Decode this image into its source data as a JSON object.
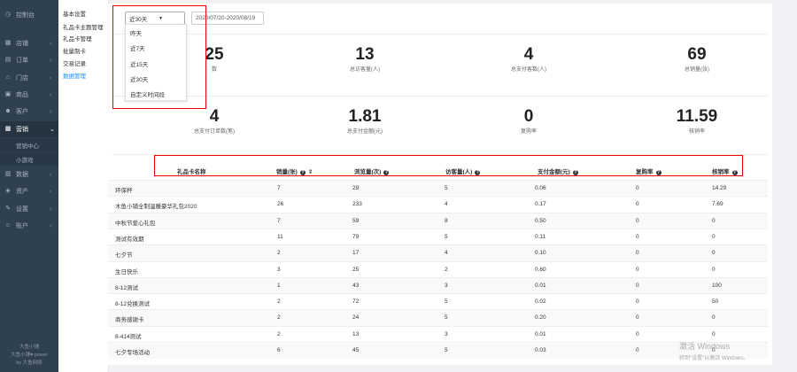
{
  "sidebar": {
    "items": [
      {
        "label": "控制台",
        "icon": "dashboard-icon",
        "glyph": "◷",
        "arrow": "",
        "active": false
      },
      {
        "label": "店铺",
        "icon": "store-icon",
        "glyph": "▦",
        "arrow": "‹",
        "active": false
      },
      {
        "label": "订单",
        "icon": "order-icon",
        "glyph": "▤",
        "arrow": "‹",
        "active": false
      },
      {
        "label": "门店",
        "icon": "shop-icon",
        "glyph": "⌂",
        "arrow": "‹",
        "active": false
      },
      {
        "label": "商品",
        "icon": "goods-icon",
        "glyph": "▣",
        "arrow": "‹",
        "active": false
      },
      {
        "label": "客户",
        "icon": "customer-icon",
        "glyph": "☻",
        "arrow": "‹",
        "active": false
      },
      {
        "label": "营销",
        "icon": "marketing-icon",
        "glyph": "▩",
        "arrow": "⌄",
        "active": true
      },
      {
        "label": "数据",
        "icon": "data-icon",
        "glyph": "▥",
        "arrow": "‹",
        "active": false
      },
      {
        "label": "资产",
        "icon": "asset-icon",
        "glyph": "◈",
        "arrow": "‹",
        "active": false
      },
      {
        "label": "设置",
        "icon": "settings-icon",
        "glyph": "✎",
        "arrow": "‹",
        "active": false
      },
      {
        "label": "账户",
        "icon": "account-icon",
        "glyph": "☺",
        "arrow": "‹",
        "active": false
      }
    ],
    "sub_items": [
      "营销中心",
      "小游戏"
    ],
    "footer": [
      "大鱼小铺",
      "大鱼小铺♥ power",
      "by 大鱼网络"
    ]
  },
  "submenu": [
    "基本设置",
    "礼品卡主题管理",
    "礼品卡管理",
    "批量制卡",
    "交易记录",
    "数据管理"
  ],
  "filter": {
    "selected": "近30天",
    "date_range": "2020/07/20-2020/08/19",
    "options": [
      "昨天",
      "近7天",
      "近15天",
      "近30天",
      "自定义时间段"
    ]
  },
  "stats_row1": [
    {
      "value": "25",
      "label": "数"
    },
    {
      "value": "13",
      "label": "总访客量(人)"
    },
    {
      "value": "4",
      "label": "总支付客数(人)"
    },
    {
      "value": "69",
      "label": "总销量(张)"
    }
  ],
  "stats_row2": [
    {
      "value": "4",
      "label": "总支付订单数(笔)"
    },
    {
      "value": "1.81",
      "label": "总支付金额(元)"
    },
    {
      "value": "0",
      "label": "复购率"
    },
    {
      "value": "11.59",
      "label": "核销率"
    }
  ],
  "table": {
    "headers": [
      "礼品卡名称",
      "销量(张)",
      "浏览量(次)",
      "访客量(人)",
      "支付金额(元)",
      "复购率",
      "核销率"
    ],
    "help_glyph": "?",
    "sort_glyph": "⇕",
    "rows": [
      [
        "环保杯",
        "7",
        "29",
        "5",
        "0.06",
        "0",
        "14.29"
      ],
      [
        "木鱼小铺全制温暖豪华礼包2020",
        "26",
        "233",
        "4",
        "0.17",
        "0",
        "7.69"
      ],
      [
        "中秋节爱心礼包",
        "7",
        "59",
        "8",
        "0.50",
        "0",
        "0"
      ],
      [
        "测试有效期",
        "11",
        "79",
        "5",
        "0.11",
        "0",
        "0"
      ],
      [
        "七夕节",
        "2",
        "17",
        "4",
        "0.10",
        "0",
        "0"
      ],
      [
        "生日快乐",
        "3",
        "25",
        "2",
        "0.60",
        "0",
        "0"
      ],
      [
        "8-12测试",
        "1",
        "43",
        "3",
        "0.01",
        "0",
        "100"
      ],
      [
        "8-12兑换测试",
        "2",
        "72",
        "5",
        "0.02",
        "0",
        "50"
      ],
      [
        "商务感谢卡",
        "2",
        "24",
        "5",
        "0.20",
        "0",
        "0"
      ],
      [
        "8-414测试",
        "2",
        "13",
        "3",
        "0.01",
        "0",
        "0"
      ],
      [
        "七夕专场活动",
        "6",
        "45",
        "5",
        "0.03",
        "0",
        "0"
      ]
    ]
  },
  "watermark": {
    "line1": "激活 Windows",
    "line2": "转到\"设置\"以激活 Windows。"
  }
}
